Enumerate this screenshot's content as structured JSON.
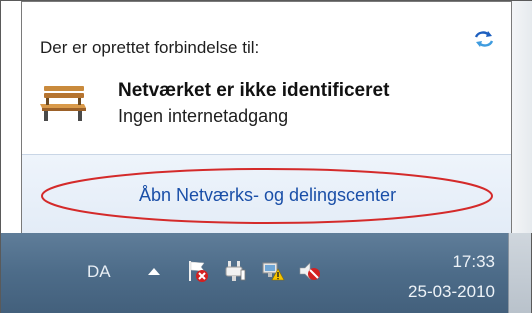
{
  "popup": {
    "connected_to": "Der er oprettet forbindelse til:",
    "network_name": "Netværket er ikke identificeret",
    "network_status": "Ingen internetadgang",
    "open_center_link": "Åbn Netværks- og delingscenter",
    "icons": {
      "refresh": "network-refresh-icon",
      "network": "bench-network-icon"
    }
  },
  "taskbar": {
    "language": "DA",
    "time": "17:33",
    "date": "25-03-2010",
    "icons": [
      "show-hidden-icons-chevron",
      "action-center-flag-icon",
      "power-plug-icon",
      "network-warning-icon",
      "speaker-muted-icon"
    ]
  },
  "colors": {
    "link": "#1a4fa8",
    "highlight_ellipse": "#d42a2a",
    "taskbar": "#4d6c89"
  }
}
